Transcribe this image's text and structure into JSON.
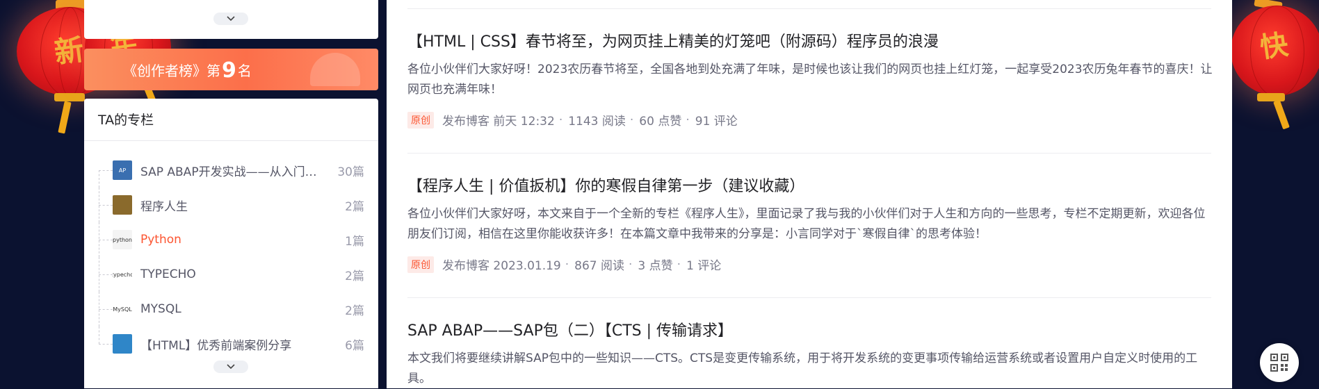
{
  "lanterns": {
    "left_char_1": "新",
    "left_char_2": "年",
    "right_char": "快"
  },
  "sidebar": {
    "expand_icon": "chevron-down-icon",
    "rank_banner": {
      "prefix": "《",
      "title": "创作者榜》第",
      "rank": "9",
      "suffix": "名"
    },
    "columns": {
      "heading": "TA的专栏",
      "items": [
        {
          "name": "SAP ABAP开发实战——从入门到精通",
          "count": "30篇",
          "thumb": "AP",
          "thumb_bg": "#3a6fb0",
          "active": false
        },
        {
          "name": "程序人生",
          "count": "2篇",
          "thumb": "",
          "thumb_bg": "#8a6a2c",
          "active": false
        },
        {
          "name": "Python",
          "count": "1篇",
          "thumb": "python",
          "thumb_bg": "#f4f4f4",
          "active": true
        },
        {
          "name": "TYPECHO",
          "count": "2篇",
          "thumb": "typecho",
          "thumb_bg": "#ffffff",
          "active": false
        },
        {
          "name": "MYSQL",
          "count": "2篇",
          "thumb": "MySQL",
          "thumb_bg": "#ffffff",
          "active": false
        },
        {
          "name": "【HTML】优秀前端案例分享",
          "count": "6篇",
          "thumb": "",
          "thumb_bg": "#2f86c8",
          "active": false
        }
      ]
    }
  },
  "articles": [
    {
      "title": "【HTML | CSS】春节将至，为网页挂上精美的灯笼吧（附源码）程序员的浪漫",
      "desc": "各位小伙伴们大家好呀！2023农历春节将至，全国各地到处充满了年味，是时候也该让我们的网页也挂上红灯笼，一起享受2023农历兔年春节的喜庆！让网页也充满年味！",
      "badge": "原创",
      "published": "发布博客 前天 12:32",
      "reads": "1143 阅读",
      "likes": "60 点赞",
      "comments": "91 评论"
    },
    {
      "title": "【程序人生 | 价值扳机】你的寒假自律第一步（建议收藏）",
      "desc": "各位小伙伴们大家好呀，本文来自于一个全新的专栏《程序人生》，里面记录了我与我的小伙伴们对于人生和方向的一些思考，专栏不定期更新，欢迎各位朋友们订阅，相信在这里你能收获许多！在本篇文章中我带来的分享是：小言同学对于`寒假自律`的思考体验！",
      "badge": "原创",
      "published": "发布博客 2023.01.19",
      "reads": "867 阅读",
      "likes": "3 点赞",
      "comments": "1 评论"
    },
    {
      "title": "SAP ABAP——SAP包（二）【CTS | 传输请求】",
      "desc": "本文我们将要继续讲解SAP包中的一些知识——CTS。CTS是变更传输系统，用于将开发系统的变更事项传输给运营系统或者设置用户自定义时使用的工具。",
      "badge": "",
      "published": "",
      "reads": "",
      "likes": "",
      "comments": ""
    }
  ],
  "meta_separator": "·",
  "qr_icon": "qrcode-icon",
  "colors": {
    "accent": "#fc5531",
    "banner": "#fc6f4a",
    "page_bg": "#0b1230"
  }
}
